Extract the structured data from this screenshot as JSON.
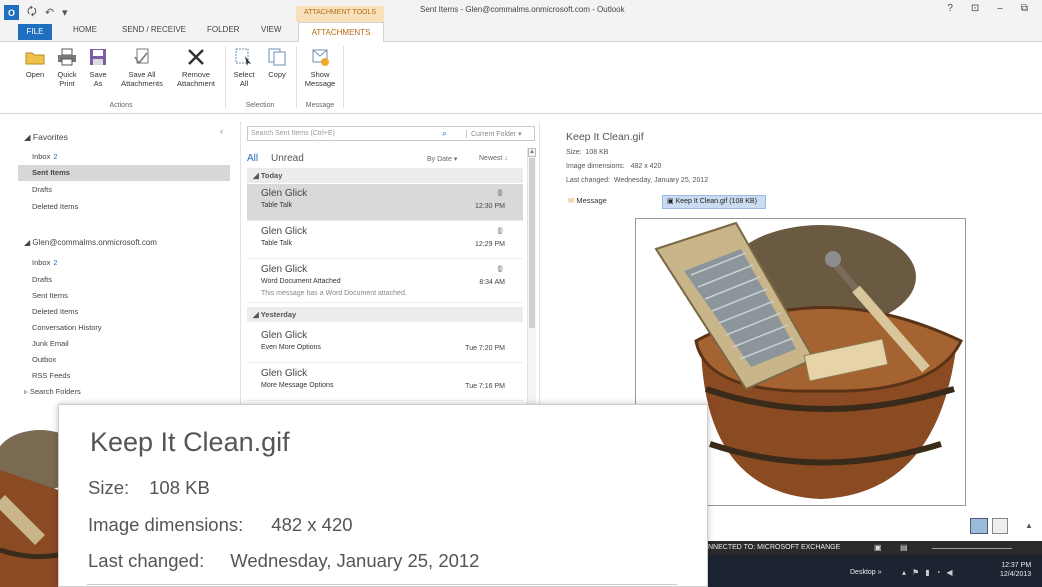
{
  "window": {
    "title": "Sent Items - Glen@commalms.onmicrosoft.com - Outlook",
    "help": "?",
    "controls": [
      "⊡",
      "–",
      "⧉"
    ]
  },
  "contextual_tab_group": "ATTACHMENT TOOLS",
  "tabs": {
    "file": "FILE",
    "home": "HOME",
    "send_receive": "SEND / RECEIVE",
    "folder": "FOLDER",
    "view": "VIEW",
    "attachments": "ATTACHMENTS"
  },
  "ribbon": {
    "open": "Open",
    "quick_print_1": "Quick",
    "quick_print_2": "Print",
    "save_as_1": "Save",
    "save_as_2": "As",
    "save_all_1": "Save All",
    "save_all_2": "Attachments",
    "remove_1": "Remove",
    "remove_2": "Attachment",
    "select_all_1": "Select",
    "select_all_2": "All",
    "copy": "Copy",
    "show_message_1": "Show",
    "show_message_2": "Message",
    "group_actions": "Actions",
    "group_selection": "Selection",
    "group_message": "Message"
  },
  "folders": {
    "favorites": "Favorites",
    "fav_items": [
      {
        "label": "Inbox",
        "count": "2"
      },
      {
        "label": "Sent Items",
        "count": ""
      },
      {
        "label": "Drafts",
        "count": ""
      },
      {
        "label": "Deleted Items",
        "count": ""
      }
    ],
    "account": "Glen@commalms.onmicrosoft.com",
    "acct_items": [
      {
        "label": "Inbox",
        "count": "2"
      },
      {
        "label": "Drafts",
        "count": ""
      },
      {
        "label": "Sent Items",
        "count": ""
      },
      {
        "label": "Deleted Items",
        "count": ""
      },
      {
        "label": "Conversation History",
        "count": ""
      },
      {
        "label": "Junk Email",
        "count": ""
      },
      {
        "label": "Outbox",
        "count": ""
      },
      {
        "label": "RSS Feeds",
        "count": ""
      },
      {
        "label": "Search Folders",
        "count": ""
      }
    ]
  },
  "message_list": {
    "search_placeholder": "Search Sent Items (Ctrl+E)",
    "search_scope": "Current Folder",
    "filter_all": "All",
    "filter_unread": "Unread",
    "sort_by": "By Date",
    "sort_order": "Newest",
    "group_today": "Today",
    "group_yesterday": "Yesterday",
    "messages": [
      {
        "from": "Glen Glick",
        "subject": "Table Talk",
        "preview": "",
        "time": "12:30 PM"
      },
      {
        "from": "Glen Glick",
        "subject": "Table Talk",
        "preview": "",
        "time": "12:29 PM"
      },
      {
        "from": "Glen Glick",
        "subject": "Word Document Attached",
        "preview": "This message has a Word Document attached.",
        "time": "8:34 AM"
      },
      {
        "from": "Glen Glick",
        "subject": "Even More Options",
        "preview": "",
        "time": "Tue 7:20 PM"
      },
      {
        "from": "Glen Glick",
        "subject": "More Message Options",
        "preview": "",
        "time": "Tue 7:16 PM"
      }
    ]
  },
  "reading_pane": {
    "filename": "Keep It Clean.gif",
    "size_label": "Size:",
    "size_value": "108 KB",
    "dims_label": "Image dimensions:",
    "dims_value": "482 x 420",
    "changed_label": "Last changed:",
    "changed_value": "Wednesday, January 25, 2012",
    "tab_message": "Message",
    "tab_attachment": "Keep It Clean.gif (108 KB)"
  },
  "status": {
    "connection": "NNECTED TO: MICROSOFT EXCHANGE"
  },
  "taskbar": {
    "desktop": "Desktop",
    "time": "12:37 PM",
    "date": "12/4/2013"
  },
  "callout": {
    "filename": "Keep It Clean.gif",
    "size_label": "Size:",
    "size_value": "108 KB",
    "dims_label": "Image dimensions:",
    "dims_value": "482 x 420",
    "changed_label": "Last changed:",
    "changed_value": "Wednesday, January 25, 2012"
  }
}
